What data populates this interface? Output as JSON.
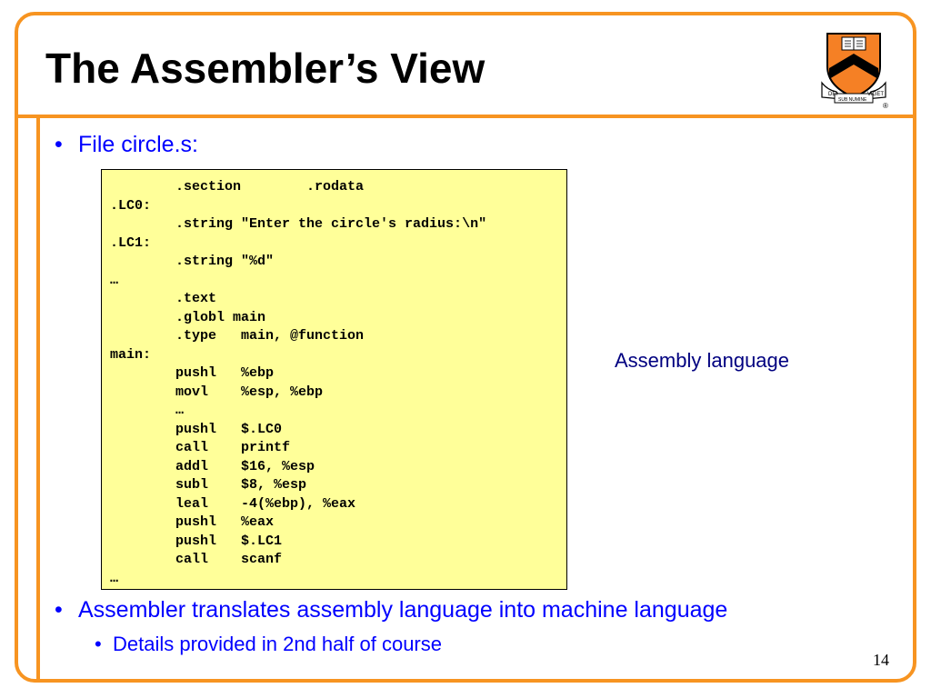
{
  "slide": {
    "title": "The Assembler’s View",
    "slide_number": "14"
  },
  "colors": {
    "frame": "#F79421",
    "bullet_text": "#0000FF",
    "caption_text": "#000080",
    "code_background": "#FFFF99"
  },
  "bullets": {
    "file": "File circle.s:",
    "assembler": "Assembler translates assembly language into machine language",
    "details": "Details provided in 2nd half of course",
    "marker": "•"
  },
  "code": {
    "lines": [
      "        .section        .rodata",
      ".LC0:",
      "        .string \"Enter the circle's radius:\\n\"",
      ".LC1:",
      "        .string \"%d\"",
      "…",
      "        .text",
      "        .globl main",
      "        .type   main, @function",
      "main:",
      "        pushl   %ebp",
      "        movl    %esp, %ebp",
      "        …",
      "        pushl   $.LC0",
      "        call    printf",
      "        addl    $16, %esp",
      "        subl    $8, %esp",
      "        leal    -4(%ebp), %eax",
      "        pushl   %eax",
      "        pushl   $.LC1",
      "        call    scanf",
      "…"
    ]
  },
  "caption": "Assembly language",
  "logo": {
    "icon": "princeton-shield-icon",
    "motto_left": "DEI",
    "motto_mid": "SUB NUMINE",
    "motto_right": "VIGET",
    "mark": "®"
  }
}
